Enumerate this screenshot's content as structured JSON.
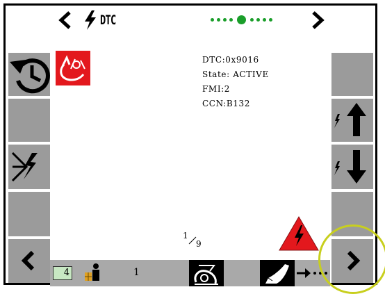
{
  "header": {
    "title": "DTC",
    "prev_icon": "chevron-left-icon",
    "title_icon": "lightning-icon",
    "next_icon": "chevron-right-icon",
    "page_dots_total": 9,
    "page_dots_active_index": 4,
    "accent_color": "#1a9e2a"
  },
  "dtc": {
    "code_label": "DTC:",
    "code_value": "0x9016",
    "state_label": "State:",
    "state_value": "ACTIVE",
    "fmi_label": "FMI:",
    "fmi_value": "2",
    "ccn_label": "CCN:",
    "ccn_value": "B132",
    "icon": "dtc-source-icon",
    "icon_color": "#e3181d"
  },
  "paging": {
    "current": "1",
    "total": "9"
  },
  "left_softkeys": [
    "history-icon",
    "blank",
    "clear-fault-icon",
    "blank",
    "chevron-left-icon"
  ],
  "right_softkeys": [
    "blank",
    "scroll-up-icon",
    "scroll-down-icon",
    "blank",
    "chevron-right-icon"
  ],
  "status_bar": {
    "gear_value": "4",
    "operator_count": "1",
    "gear_icon": "gear-indicator-icon",
    "operator_icon": "operator-icon",
    "seat_icon": "seat-belt-icon",
    "bucket_icon": "bucket-icon"
  },
  "warning_icon": "high-voltage-warning-icon",
  "warning_color": "#e3181d",
  "highlight_color": "#c8cf1e"
}
